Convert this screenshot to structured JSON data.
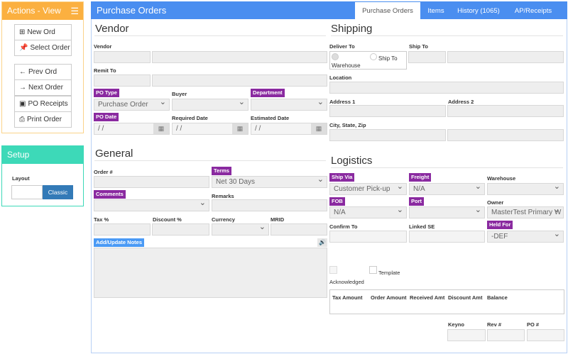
{
  "actions": {
    "title": "Actions - View",
    "buttons": [
      "New Ord",
      "Select Order",
      "Prev Ord",
      "Next Order",
      "PO Receipts",
      "Print Order"
    ]
  },
  "setup": {
    "title": "Setup",
    "layout_label": "Layout",
    "layout_value": "",
    "classic_label": "Classic"
  },
  "header": {
    "title": "Purchase Orders",
    "tabs": [
      "Purchase Orders",
      "Items",
      "History (1065)",
      "AP/Receipts"
    ],
    "active_tab": "Purchase Orders"
  },
  "vendor": {
    "heading": "Vendor",
    "vendor_label": "Vendor",
    "remit_label": "Remit To",
    "po_type_label": "PO Type",
    "po_type_value": "Purchase Order",
    "buyer_label": "Buyer",
    "department_label": "Department",
    "po_date_label": "PO Date",
    "po_date_value": " /  /",
    "required_date_label": "Required Date",
    "required_date_value": " /  /",
    "estimated_date_label": "Estimated Date",
    "estimated_date_value": " /  /"
  },
  "general": {
    "heading": "General",
    "order_label": "Order #",
    "terms_label": "Terms",
    "terms_value": "Net 30 Days",
    "comments_label": "Comments",
    "remarks_label": "Remarks",
    "tax_label": "Tax %",
    "discount_label": "Discount %",
    "currency_label": "Currency",
    "mrid_label": "MRID",
    "notes_label": "Add/Update Notes"
  },
  "shipping": {
    "heading": "Shipping",
    "deliver_label": "Deliver To",
    "opt_warehouse": "Warehouse",
    "opt_shipto": "Ship To",
    "shipto_label": "Ship To",
    "location_label": "Location",
    "address1_label": "Address 1",
    "address2_label": "Address 2",
    "city_label": "City, State, Zip"
  },
  "logistics": {
    "heading": "Logistics",
    "shipvia_label": "Ship Via",
    "shipvia_value": "Customer Pick-up",
    "freight_label": "Freight",
    "freight_value": "N/A",
    "warehouse_label": "Warehouse",
    "fob_label": "FOB",
    "fob_value": "N/A",
    "port_label": "Port",
    "owner_label": "Owner",
    "owner_value": "MasterTest Primary W",
    "confirm_label": "Confirm To",
    "linked_label": "Linked SE",
    "heldfor_label": "Held For",
    "heldfor_value": "-DEF",
    "acknowledged_label": "Acknowledged",
    "template_label": "Template",
    "totals_headers": [
      "Tax Amount",
      "Order Amount",
      "Received Amt",
      "Discount Amt",
      "Balance"
    ],
    "keyno_label": "Keyno",
    "rev_label": "Rev #",
    "po_label": "PO #"
  },
  "colors": {
    "actions": "#fbb040",
    "setup": "#3dd9b8",
    "header": "#4a8ef0",
    "badge": "#8a2aa0",
    "classic": "#337ab7"
  }
}
